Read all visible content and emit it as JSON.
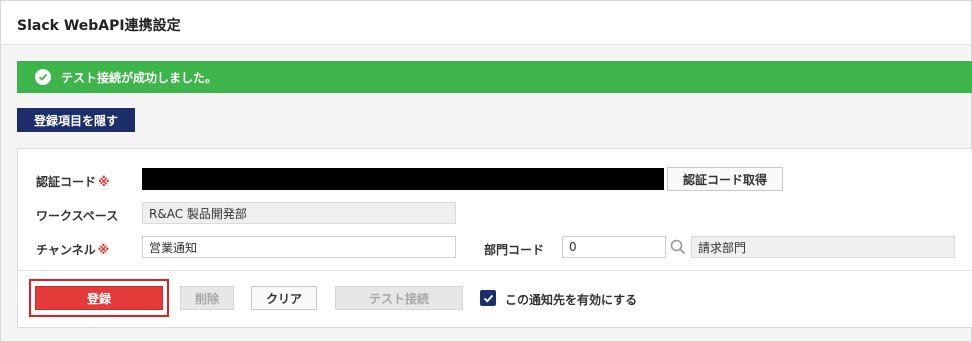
{
  "header": {
    "title": "Slack WebAPI連携設定"
  },
  "alert": {
    "message": "テスト接続が成功しました。",
    "color": "#3eb54a"
  },
  "toggle_button": {
    "label": "登録項目を隠す"
  },
  "form": {
    "auth_code": {
      "label": "認証コード",
      "required_mark": "※",
      "value": "",
      "fetch_button": "認証コード取得"
    },
    "workspace": {
      "label": "ワークスペース",
      "value": "R&AC 製品開発部"
    },
    "channel": {
      "label": "チャンネル",
      "required_mark": "※",
      "value": "営業通知"
    },
    "department": {
      "label": "部門コード",
      "value": "0",
      "name_value": "請求部門"
    }
  },
  "actions": {
    "register": "登録",
    "delete": "削除",
    "clear": "クリア",
    "test_connection": "テスト接続",
    "enable_label": "この通知先を有効にする",
    "enable_checked": true
  },
  "colors": {
    "primary_button": "#e53a3a",
    "navy": "#1d2f6b",
    "required": "#e53935"
  }
}
